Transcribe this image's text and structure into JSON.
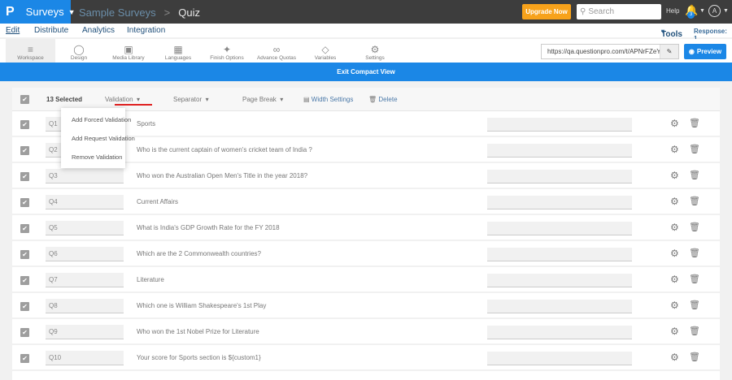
{
  "topbar": {
    "logo": "P",
    "app": "Surveys",
    "breadcrumb": [
      "Sample Surveys",
      "Quiz"
    ],
    "upgrade": "Upgrade Now",
    "search_placeholder": "Search",
    "help": "Help",
    "notifications": "3",
    "avatar": "A"
  },
  "nav": {
    "tabs": [
      "Edit",
      "Distribute",
      "Analytics",
      "Integration"
    ],
    "tools": "Tools",
    "response": "Response: 1"
  },
  "toolbar": {
    "items": [
      "Workspace",
      "Design",
      "Media Library",
      "Languages",
      "Finish Options",
      "Advance Quotas",
      "Variables",
      "Settings"
    ],
    "url": "https://qa.questionpro.com/t/APNrFZeY",
    "preview": "Preview"
  },
  "exit_compact": "Exit Compact View",
  "bulk": {
    "selected": "13 Selected",
    "validation": "Validation",
    "separator": "Separator",
    "page_break": "Page Break",
    "width_settings": "Width Settings",
    "delete": "Delete"
  },
  "validation_menu": [
    "Add Forced Validation",
    "Add Request Validation",
    "Remove Validation"
  ],
  "questions": [
    {
      "id": "Q1",
      "text": "Sports"
    },
    {
      "id": "Q2",
      "text": "Who is the current captain of women's cricket team of India ?"
    },
    {
      "id": "Q3",
      "text": "Who won the Australian Open Men's Title in the year 2018?"
    },
    {
      "id": "Q4",
      "text": "Current Affairs"
    },
    {
      "id": "Q5",
      "text": "What is India's GDP Growth Rate for the FY 2018"
    },
    {
      "id": "Q6",
      "text": "Which are the 2 Commonwealth countries?"
    },
    {
      "id": "Q7",
      "text": "Literature"
    },
    {
      "id": "Q8",
      "text": "Which one is William Shakespeare's 1st Play"
    },
    {
      "id": "Q9",
      "text": "Who won the 1st Nobel Prize for Literature"
    },
    {
      "id": "Q10",
      "text": "Your score for Sports section is ${custom1}"
    }
  ]
}
